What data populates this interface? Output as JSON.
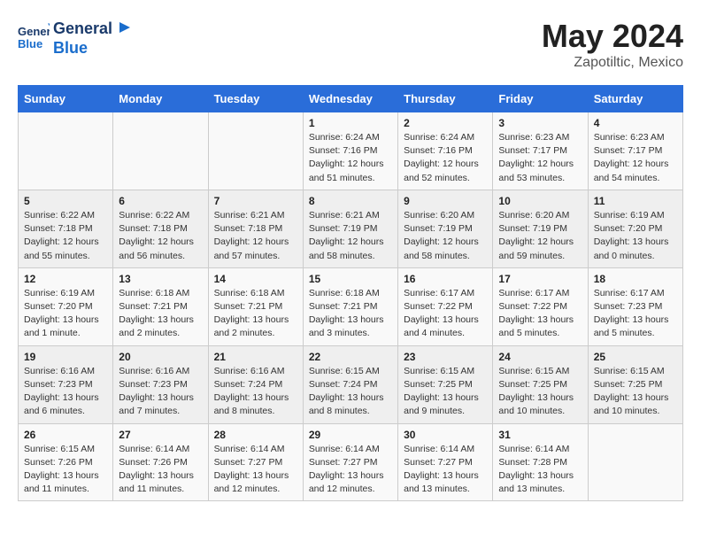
{
  "header": {
    "logo_general": "General",
    "logo_blue": "Blue",
    "month": "May 2024",
    "location": "Zapotiltic, Mexico"
  },
  "days_of_week": [
    "Sunday",
    "Monday",
    "Tuesday",
    "Wednesday",
    "Thursday",
    "Friday",
    "Saturday"
  ],
  "weeks": [
    [
      {
        "day": "",
        "sunrise": "",
        "sunset": "",
        "daylight": ""
      },
      {
        "day": "",
        "sunrise": "",
        "sunset": "",
        "daylight": ""
      },
      {
        "day": "",
        "sunrise": "",
        "sunset": "",
        "daylight": ""
      },
      {
        "day": "1",
        "sunrise": "Sunrise: 6:24 AM",
        "sunset": "Sunset: 7:16 PM",
        "daylight": "Daylight: 12 hours and 51 minutes."
      },
      {
        "day": "2",
        "sunrise": "Sunrise: 6:24 AM",
        "sunset": "Sunset: 7:16 PM",
        "daylight": "Daylight: 12 hours and 52 minutes."
      },
      {
        "day": "3",
        "sunrise": "Sunrise: 6:23 AM",
        "sunset": "Sunset: 7:17 PM",
        "daylight": "Daylight: 12 hours and 53 minutes."
      },
      {
        "day": "4",
        "sunrise": "Sunrise: 6:23 AM",
        "sunset": "Sunset: 7:17 PM",
        "daylight": "Daylight: 12 hours and 54 minutes."
      }
    ],
    [
      {
        "day": "5",
        "sunrise": "Sunrise: 6:22 AM",
        "sunset": "Sunset: 7:18 PM",
        "daylight": "Daylight: 12 hours and 55 minutes."
      },
      {
        "day": "6",
        "sunrise": "Sunrise: 6:22 AM",
        "sunset": "Sunset: 7:18 PM",
        "daylight": "Daylight: 12 hours and 56 minutes."
      },
      {
        "day": "7",
        "sunrise": "Sunrise: 6:21 AM",
        "sunset": "Sunset: 7:18 PM",
        "daylight": "Daylight: 12 hours and 57 minutes."
      },
      {
        "day": "8",
        "sunrise": "Sunrise: 6:21 AM",
        "sunset": "Sunset: 7:19 PM",
        "daylight": "Daylight: 12 hours and 58 minutes."
      },
      {
        "day": "9",
        "sunrise": "Sunrise: 6:20 AM",
        "sunset": "Sunset: 7:19 PM",
        "daylight": "Daylight: 12 hours and 58 minutes."
      },
      {
        "day": "10",
        "sunrise": "Sunrise: 6:20 AM",
        "sunset": "Sunset: 7:19 PM",
        "daylight": "Daylight: 12 hours and 59 minutes."
      },
      {
        "day": "11",
        "sunrise": "Sunrise: 6:19 AM",
        "sunset": "Sunset: 7:20 PM",
        "daylight": "Daylight: 13 hours and 0 minutes."
      }
    ],
    [
      {
        "day": "12",
        "sunrise": "Sunrise: 6:19 AM",
        "sunset": "Sunset: 7:20 PM",
        "daylight": "Daylight: 13 hours and 1 minute."
      },
      {
        "day": "13",
        "sunrise": "Sunrise: 6:18 AM",
        "sunset": "Sunset: 7:21 PM",
        "daylight": "Daylight: 13 hours and 2 minutes."
      },
      {
        "day": "14",
        "sunrise": "Sunrise: 6:18 AM",
        "sunset": "Sunset: 7:21 PM",
        "daylight": "Daylight: 13 hours and 2 minutes."
      },
      {
        "day": "15",
        "sunrise": "Sunrise: 6:18 AM",
        "sunset": "Sunset: 7:21 PM",
        "daylight": "Daylight: 13 hours and 3 minutes."
      },
      {
        "day": "16",
        "sunrise": "Sunrise: 6:17 AM",
        "sunset": "Sunset: 7:22 PM",
        "daylight": "Daylight: 13 hours and 4 minutes."
      },
      {
        "day": "17",
        "sunrise": "Sunrise: 6:17 AM",
        "sunset": "Sunset: 7:22 PM",
        "daylight": "Daylight: 13 hours and 5 minutes."
      },
      {
        "day": "18",
        "sunrise": "Sunrise: 6:17 AM",
        "sunset": "Sunset: 7:23 PM",
        "daylight": "Daylight: 13 hours and 5 minutes."
      }
    ],
    [
      {
        "day": "19",
        "sunrise": "Sunrise: 6:16 AM",
        "sunset": "Sunset: 7:23 PM",
        "daylight": "Daylight: 13 hours and 6 minutes."
      },
      {
        "day": "20",
        "sunrise": "Sunrise: 6:16 AM",
        "sunset": "Sunset: 7:23 PM",
        "daylight": "Daylight: 13 hours and 7 minutes."
      },
      {
        "day": "21",
        "sunrise": "Sunrise: 6:16 AM",
        "sunset": "Sunset: 7:24 PM",
        "daylight": "Daylight: 13 hours and 8 minutes."
      },
      {
        "day": "22",
        "sunrise": "Sunrise: 6:15 AM",
        "sunset": "Sunset: 7:24 PM",
        "daylight": "Daylight: 13 hours and 8 minutes."
      },
      {
        "day": "23",
        "sunrise": "Sunrise: 6:15 AM",
        "sunset": "Sunset: 7:25 PM",
        "daylight": "Daylight: 13 hours and 9 minutes."
      },
      {
        "day": "24",
        "sunrise": "Sunrise: 6:15 AM",
        "sunset": "Sunset: 7:25 PM",
        "daylight": "Daylight: 13 hours and 10 minutes."
      },
      {
        "day": "25",
        "sunrise": "Sunrise: 6:15 AM",
        "sunset": "Sunset: 7:25 PM",
        "daylight": "Daylight: 13 hours and 10 minutes."
      }
    ],
    [
      {
        "day": "26",
        "sunrise": "Sunrise: 6:15 AM",
        "sunset": "Sunset: 7:26 PM",
        "daylight": "Daylight: 13 hours and 11 minutes."
      },
      {
        "day": "27",
        "sunrise": "Sunrise: 6:14 AM",
        "sunset": "Sunset: 7:26 PM",
        "daylight": "Daylight: 13 hours and 11 minutes."
      },
      {
        "day": "28",
        "sunrise": "Sunrise: 6:14 AM",
        "sunset": "Sunset: 7:27 PM",
        "daylight": "Daylight: 13 hours and 12 minutes."
      },
      {
        "day": "29",
        "sunrise": "Sunrise: 6:14 AM",
        "sunset": "Sunset: 7:27 PM",
        "daylight": "Daylight: 13 hours and 12 minutes."
      },
      {
        "day": "30",
        "sunrise": "Sunrise: 6:14 AM",
        "sunset": "Sunset: 7:27 PM",
        "daylight": "Daylight: 13 hours and 13 minutes."
      },
      {
        "day": "31",
        "sunrise": "Sunrise: 6:14 AM",
        "sunset": "Sunset: 7:28 PM",
        "daylight": "Daylight: 13 hours and 13 minutes."
      },
      {
        "day": "",
        "sunrise": "",
        "sunset": "",
        "daylight": ""
      }
    ]
  ]
}
